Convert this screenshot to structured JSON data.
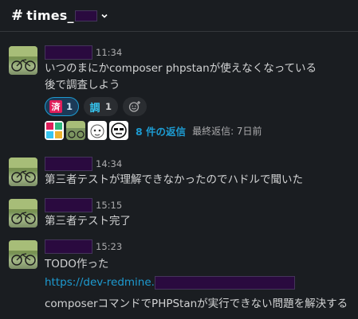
{
  "channel": {
    "prefix": "#",
    "name": "times_"
  },
  "messages": [
    {
      "time": "11:34",
      "lines": [
        "いつのまにかcomposer phpstanが使えなくなっている",
        "後で調査しよう"
      ],
      "reactions": [
        {
          "emoji": "済",
          "count": "1",
          "active": true
        },
        {
          "emoji": "調",
          "count": "1",
          "active": false
        }
      ],
      "thread": {
        "replies": "8 件の返信",
        "last_reply": "最終返信: 7日前"
      }
    },
    {
      "time": "14:34",
      "lines": [
        "第三者テストが理解できなかったのでハドルで聞いた"
      ]
    },
    {
      "time": "15:15",
      "lines": [
        "第三者テスト完了"
      ]
    },
    {
      "time": "15:23",
      "lines": [
        "TODO作った"
      ],
      "link_text": "https://dev-redmine.",
      "extra": "composerコマンドでPHPStanが実行できない問題を解決する"
    }
  ],
  "colors": {
    "background": "#1a1d21",
    "link": "#1d9bd1",
    "redaction": "#2a0a3f"
  },
  "icons": [
    "chevron-down-icon",
    "add-reaction-icon"
  ]
}
